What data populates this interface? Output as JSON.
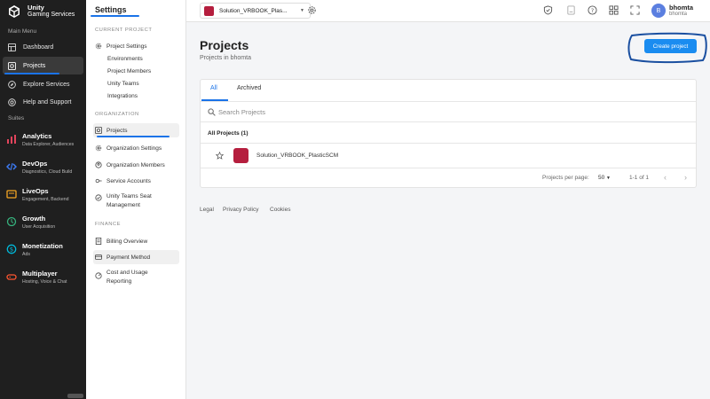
{
  "brand": {
    "line1": "Unity",
    "line2": "Gaming Services"
  },
  "leftnav": {
    "main_menu_label": "Main Menu",
    "items": [
      {
        "label": "Dashboard",
        "icon": "dashboard-icon"
      },
      {
        "label": "Projects",
        "icon": "projects-icon",
        "active": true
      },
      {
        "label": "Explore Services",
        "icon": "explore-icon"
      },
      {
        "label": "Help and Support",
        "icon": "help-icon"
      }
    ],
    "suites_label": "Suites",
    "suites": [
      {
        "title": "Analytics",
        "sub": "Data Explorer, Audiences",
        "color": "#e2445c"
      },
      {
        "title": "DevOps",
        "sub": "Diagnostics, Cloud Build",
        "color": "#3d7bf5"
      },
      {
        "title": "LiveOps",
        "sub": "Engagement, Backend",
        "color": "#f5a623"
      },
      {
        "title": "Growth",
        "sub": "User Acquisition",
        "color": "#36b37e"
      },
      {
        "title": "Monetization",
        "sub": "Ads",
        "color": "#00b8d9"
      },
      {
        "title": "Multiplayer",
        "sub": "Hosting, Voice & Chat",
        "color": "#ff5630"
      }
    ]
  },
  "settings": {
    "title": "Settings",
    "current_project_label": "CURRENT PROJECT",
    "project_settings": "Project Settings",
    "environments": "Environments",
    "project_members": "Project Members",
    "unity_teams": "Unity Teams",
    "integrations": "Integrations",
    "organization_label": "ORGANIZATION",
    "projects": "Projects",
    "org_settings": "Organization Settings",
    "org_members": "Organization Members",
    "service_accounts": "Service Accounts",
    "teams_seat_1": "Unity Teams Seat",
    "teams_seat_2": "Management",
    "finance_label": "FINANCE",
    "billing": "Billing Overview",
    "payment": "Payment Method",
    "cost_1": "Cost and Usage",
    "cost_2": "Reporting"
  },
  "topbar": {
    "project_name": "Solution_VRBOOK_Plas...",
    "user_initial": "B",
    "user_name": "bhomta",
    "user_sub": "bhomta"
  },
  "main": {
    "title": "Projects",
    "subtitle": "Projects in bhomta",
    "create_button": "Create project",
    "tabs": [
      "All",
      "Archived"
    ],
    "search_placeholder": "Search Projects",
    "all_projects": "All Projects (1)",
    "rows": [
      {
        "name": "Solution_VRBOOK_PlasticSCM"
      }
    ],
    "pager_label": "Projects per page:",
    "pager_value": "50",
    "pager_range": "1-1 of 1"
  },
  "footer": {
    "legal": "Legal",
    "privacy": "Privacy Policy",
    "cookies": "Cookies"
  },
  "colors": {
    "accent": "#1a73e8",
    "button": "#1a8cf0",
    "project_avatar": "#b51e3e",
    "nav_bg": "#1f1f1f"
  }
}
